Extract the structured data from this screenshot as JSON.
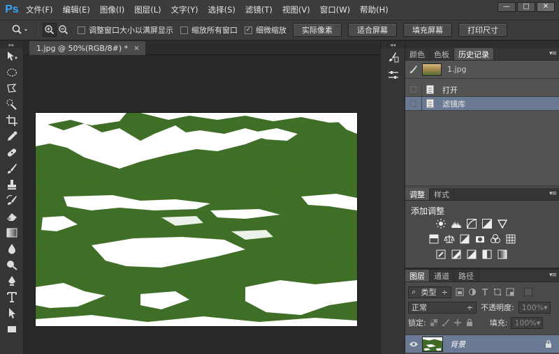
{
  "app": {
    "logo": "Ps"
  },
  "menu": [
    "文件(F)",
    "编辑(E)",
    "图像(I)",
    "图层(L)",
    "文字(Y)",
    "选择(S)",
    "滤镜(T)",
    "视图(V)",
    "窗口(W)",
    "帮助(H)"
  ],
  "window_controls": {
    "minimize": "—",
    "restore": "□",
    "close": "✕"
  },
  "options_bar": {
    "tool_icon": "zoom-icon",
    "checkbox_resize": {
      "label": "调整窗口大小以满屏显示",
      "checked": false
    },
    "checkbox_zoom_all": {
      "label": "缩放所有窗口",
      "checked": false
    },
    "checkbox_scrubby": {
      "label": "细微缩放",
      "checked": true
    },
    "buttons": [
      "实际像素",
      "适合屏幕",
      "填充屏幕",
      "打印尺寸"
    ]
  },
  "document": {
    "tab_title": "1.jpg @ 50%(RGB/8#) *",
    "tab_close": "×"
  },
  "panels": {
    "history": {
      "tabs": [
        "颜色",
        "色板",
        "历史记录"
      ],
      "active_tab": "历史记录",
      "snapshot_name": "1.jpg",
      "states": [
        {
          "name": "打开",
          "selected": false
        },
        {
          "name": "滤镜库",
          "selected": true
        }
      ]
    },
    "adjustments": {
      "tabs": [
        "调整",
        "样式"
      ],
      "active_tab": "调整",
      "title": "添加调整"
    },
    "layers": {
      "tabs": [
        "图层",
        "通道",
        "路径"
      ],
      "active_tab": "图层",
      "filter_kind": "类型",
      "blend_mode": "正常",
      "opacity_label": "不透明度:",
      "opacity_value": "100%",
      "lock_label": "锁定:",
      "fill_label": "填充:",
      "fill_value": "100%",
      "layer_name": "背景"
    }
  },
  "colors": {
    "accent_selected": "#6b7a94",
    "image_green": "#3f6b27"
  }
}
